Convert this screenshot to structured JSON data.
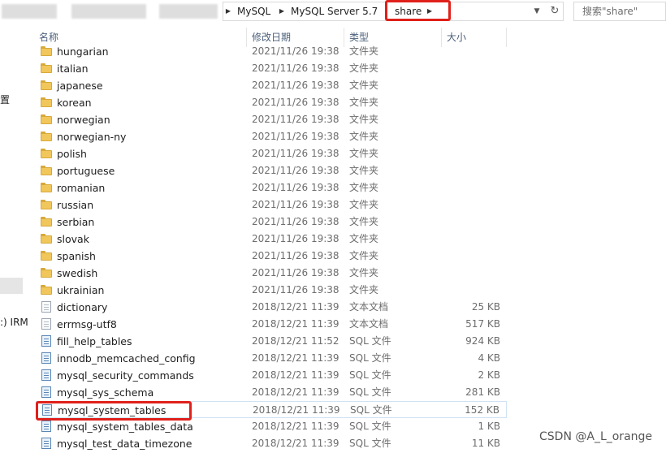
{
  "address": {
    "breadcrumbs": [
      "MySQL",
      "MySQL Server 5.7",
      "share"
    ],
    "search_placeholder": "搜索\"share\""
  },
  "nav": {
    "fragment_1": "置",
    "fragment_2": ":) IRM"
  },
  "columns": [
    "名称",
    "修改日期",
    "类型",
    "大小"
  ],
  "files": [
    {
      "name": "hungarian",
      "date": "2021/11/26 19:38",
      "type": "文件夹",
      "size": "",
      "icon": "folder-icon"
    },
    {
      "name": "italian",
      "date": "2021/11/26 19:38",
      "type": "文件夹",
      "size": "",
      "icon": "folder-icon"
    },
    {
      "name": "japanese",
      "date": "2021/11/26 19:38",
      "type": "文件夹",
      "size": "",
      "icon": "folder-icon"
    },
    {
      "name": "korean",
      "date": "2021/11/26 19:38",
      "type": "文件夹",
      "size": "",
      "icon": "folder-icon"
    },
    {
      "name": "norwegian",
      "date": "2021/11/26 19:38",
      "type": "文件夹",
      "size": "",
      "icon": "folder-icon"
    },
    {
      "name": "norwegian-ny",
      "date": "2021/11/26 19:38",
      "type": "文件夹",
      "size": "",
      "icon": "folder-icon"
    },
    {
      "name": "polish",
      "date": "2021/11/26 19:38",
      "type": "文件夹",
      "size": "",
      "icon": "folder-icon"
    },
    {
      "name": "portuguese",
      "date": "2021/11/26 19:38",
      "type": "文件夹",
      "size": "",
      "icon": "folder-icon"
    },
    {
      "name": "romanian",
      "date": "2021/11/26 19:38",
      "type": "文件夹",
      "size": "",
      "icon": "folder-icon"
    },
    {
      "name": "russian",
      "date": "2021/11/26 19:38",
      "type": "文件夹",
      "size": "",
      "icon": "folder-icon"
    },
    {
      "name": "serbian",
      "date": "2021/11/26 19:38",
      "type": "文件夹",
      "size": "",
      "icon": "folder-icon"
    },
    {
      "name": "slovak",
      "date": "2021/11/26 19:38",
      "type": "文件夹",
      "size": "",
      "icon": "folder-icon"
    },
    {
      "name": "spanish",
      "date": "2021/11/26 19:38",
      "type": "文件夹",
      "size": "",
      "icon": "folder-icon"
    },
    {
      "name": "swedish",
      "date": "2021/11/26 19:38",
      "type": "文件夹",
      "size": "",
      "icon": "folder-icon"
    },
    {
      "name": "ukrainian",
      "date": "2021/11/26 19:38",
      "type": "文件夹",
      "size": "",
      "icon": "folder-icon"
    },
    {
      "name": "dictionary",
      "date": "2018/12/21 11:39",
      "type": "文本文档",
      "size": "25 KB",
      "icon": "text-file-icon"
    },
    {
      "name": "errmsg-utf8",
      "date": "2018/12/21 11:39",
      "type": "文本文档",
      "size": "517 KB",
      "icon": "text-file-icon"
    },
    {
      "name": "fill_help_tables",
      "date": "2018/12/21 11:52",
      "type": "SQL 文件",
      "size": "924 KB",
      "icon": "sql-file-icon"
    },
    {
      "name": "innodb_memcached_config",
      "date": "2018/12/21 11:39",
      "type": "SQL 文件",
      "size": "4 KB",
      "icon": "sql-file-icon"
    },
    {
      "name": "mysql_security_commands",
      "date": "2018/12/21 11:39",
      "type": "SQL 文件",
      "size": "2 KB",
      "icon": "sql-file-icon"
    },
    {
      "name": "mysql_sys_schema",
      "date": "2018/12/21 11:39",
      "type": "SQL 文件",
      "size": "281 KB",
      "icon": "sql-file-icon"
    },
    {
      "name": "mysql_system_tables",
      "date": "2018/12/21 11:39",
      "type": "SQL 文件",
      "size": "152 KB",
      "icon": "sql-file-icon"
    },
    {
      "name": "mysql_system_tables_data",
      "date": "2018/12/21 11:39",
      "type": "SQL 文件",
      "size": "1 KB",
      "icon": "sql-file-icon"
    },
    {
      "name": "mysql_test_data_timezone",
      "date": "2018/12/21 11:39",
      "type": "SQL 文件",
      "size": "11 KB",
      "icon": "sql-file-icon"
    }
  ],
  "watermark": "CSDN @A_L_orange",
  "colors": {
    "highlight": "#e0201a",
    "header_text": "#4c607a",
    "folder": "#f1c75b"
  }
}
